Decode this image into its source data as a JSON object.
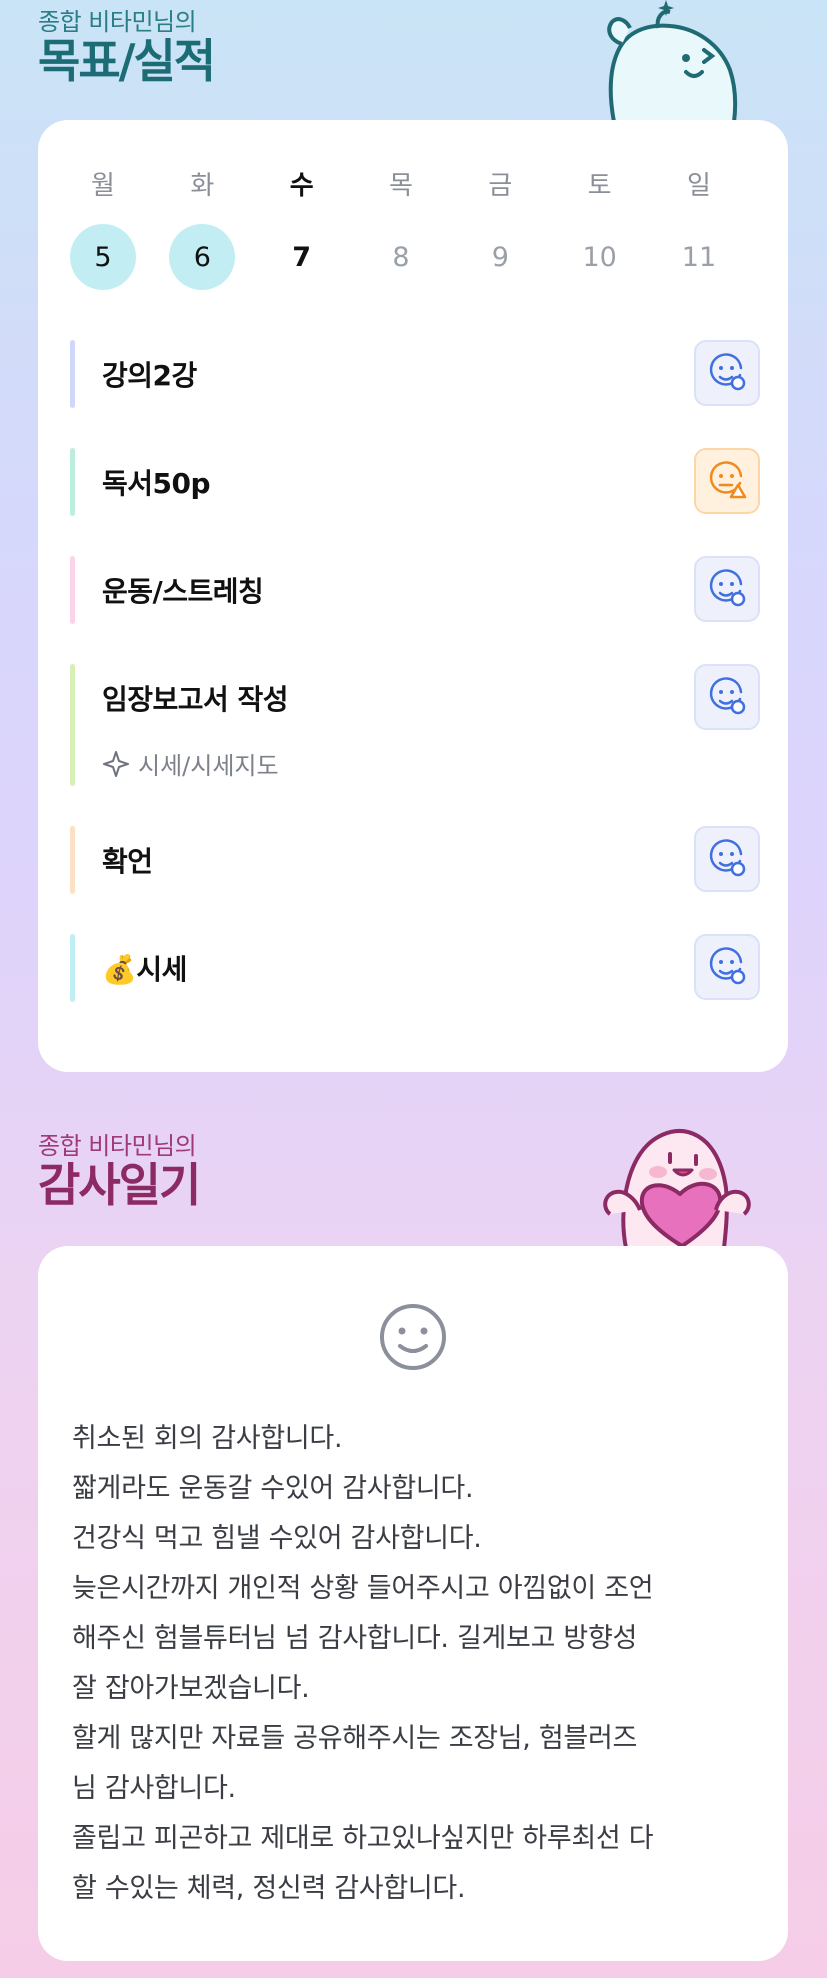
{
  "goal_section": {
    "subtitle": "종합 비타민님의",
    "title": "목표/실적"
  },
  "week": [
    {
      "day": "월",
      "date": "5",
      "state": "done"
    },
    {
      "day": "화",
      "date": "6",
      "state": "done"
    },
    {
      "day": "수",
      "date": "7",
      "state": "today"
    },
    {
      "day": "목",
      "date": "8",
      "state": "future"
    },
    {
      "day": "금",
      "date": "9",
      "state": "future"
    },
    {
      "day": "토",
      "date": "10",
      "state": "future"
    },
    {
      "day": "일",
      "date": "11",
      "state": "future"
    }
  ],
  "goals": [
    {
      "label": "강의2강",
      "bar_color": "#cfd8fb",
      "status_icon": "smile-check-icon",
      "status": "done"
    },
    {
      "label": "독서50p",
      "bar_color": "#bdeedb",
      "status_icon": "smile-warning-icon",
      "status": "warning"
    },
    {
      "label": "운동/스트레칭",
      "bar_color": "#fbd3ea",
      "status_icon": "smile-check-icon",
      "status": "done"
    },
    {
      "label": "임장보고서 작성",
      "bar_color": "#d7f0b6",
      "status_icon": "smile-check-icon",
      "status": "done",
      "sub": "시세/시세지도",
      "sub_icon": "sparkle-icon"
    },
    {
      "label": "확언",
      "bar_color": "#fde0c4",
      "status_icon": "smile-check-icon",
      "status": "done"
    },
    {
      "label": "💰시세",
      "bar_color": "#bfeef3",
      "status_icon": "smile-check-icon",
      "status": "done"
    }
  ],
  "thanks_section": {
    "subtitle": "종합 비타민님의",
    "title": "감사일기",
    "mood_icon": "smiley-face-icon",
    "lines": [
      "취소된 회의 감사합니다.",
      "짧게라도 운동갈 수있어 감사합니다.",
      "건강식 먹고 힘낼 수있어 감사합니다.",
      "늦은시간까지 개인적 상황 들어주시고 아낌없이 조언",
      "해주신 험블튜터님 넘 감사합니다. 길게보고 방향성",
      "잘 잡아가보겠습니다.",
      "할게 많지만 자료들 공유해주시는 조장님, 험블러즈",
      "님 감사합니다.",
      "졸립고 피곤하고 제대로 하고있나싶지만 하루최선 다",
      "할 수있는 체력, 정신력 감사합니다."
    ]
  },
  "colors": {
    "done_day": "#c2eef3",
    "goal_title": "#1c6c75",
    "thanks_title": "#8b2a63",
    "check_icon": "#3f6fe0",
    "warning_icon": "#f08a1c"
  }
}
